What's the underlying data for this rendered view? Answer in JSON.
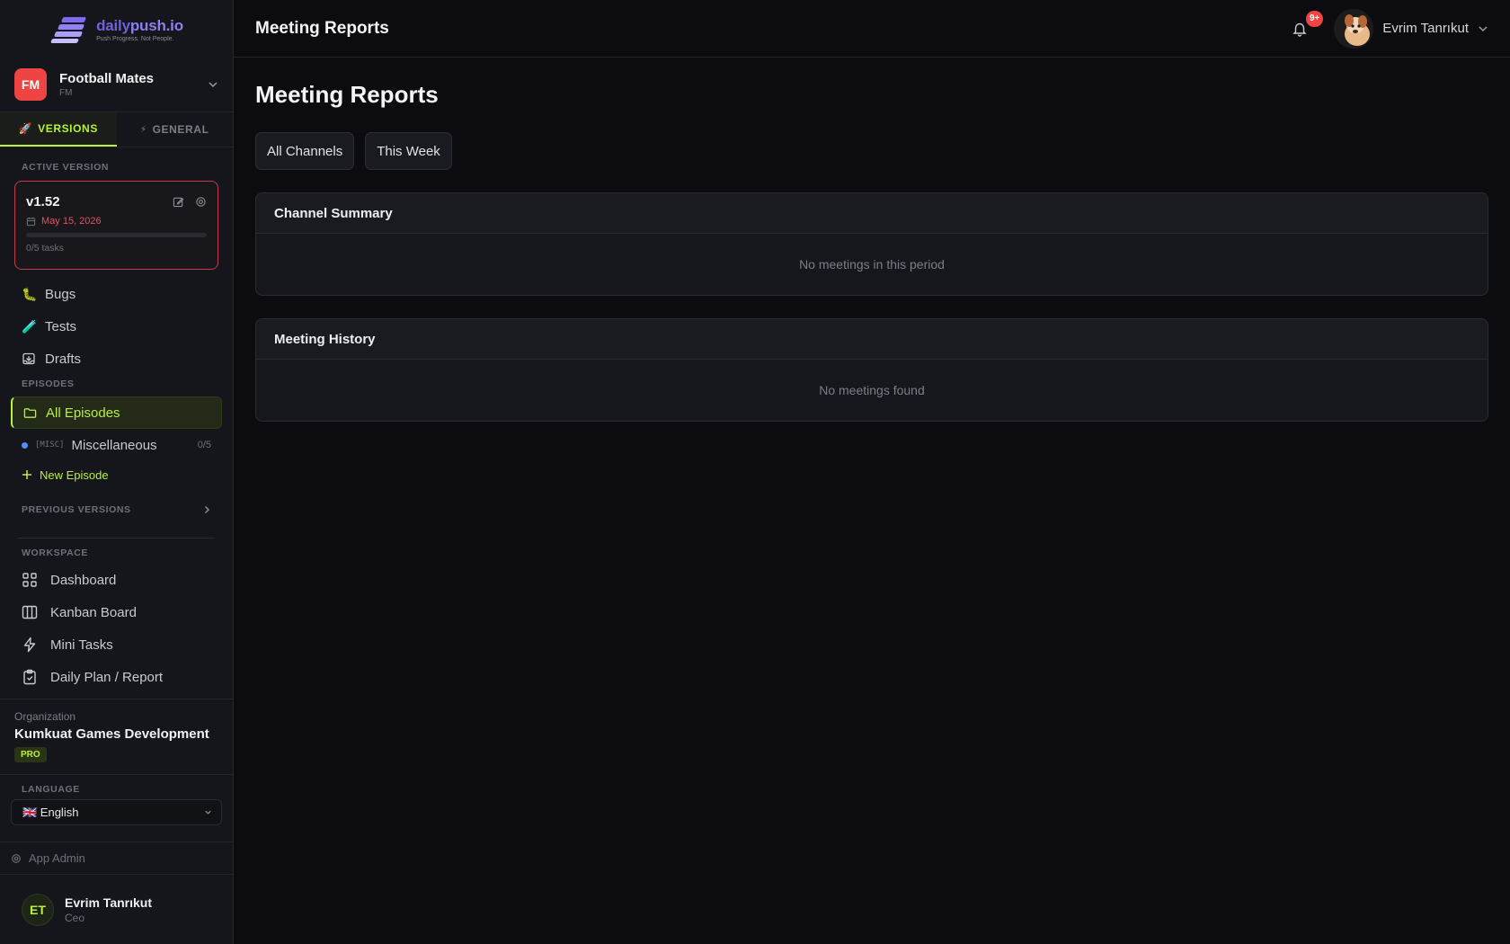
{
  "brand": {
    "name_part1": "daily",
    "name_part2": "push.io",
    "tagline": "Push Progress. Not People."
  },
  "project": {
    "initials": "FM",
    "name": "Football Mates",
    "code": "FM",
    "color": "#ef4444"
  },
  "tabs": [
    {
      "icon": "🚀",
      "label": "VERSIONS",
      "active": true
    },
    {
      "icon": "⚡",
      "label": "GENERAL",
      "active": false
    }
  ],
  "active_version": {
    "section_label": "ACTIVE VERSION",
    "title": "v1.52",
    "date": "May 15, 2026",
    "progress": 0,
    "tasks": "0/5 tasks"
  },
  "version_nav": [
    {
      "icon": "bug-icon",
      "label": "Bugs"
    },
    {
      "icon": "test-tube-icon",
      "label": "Tests"
    },
    {
      "icon": "inbox-icon",
      "label": "Drafts"
    }
  ],
  "episodes": {
    "section_label": "EPISODES",
    "all_label": "All Episodes",
    "items": [
      {
        "tag": "[MISC]",
        "label": "Miscellaneous",
        "count": "0/5",
        "color": "#4f8ff7"
      }
    ],
    "new_label": "New Episode"
  },
  "previous_versions_label": "PREVIOUS VERSIONS",
  "workspace": {
    "section_label": "WORKSPACE",
    "items": [
      {
        "icon": "grid-icon",
        "label": "Dashboard"
      },
      {
        "icon": "kanban-icon",
        "label": "Kanban Board"
      },
      {
        "icon": "lightning-icon",
        "label": "Mini Tasks"
      },
      {
        "icon": "clipboard-check-icon",
        "label": "Daily Plan / Report"
      }
    ]
  },
  "organization": {
    "label": "Organization",
    "name": "Kumkuat Games Development",
    "plan": "PRO"
  },
  "language": {
    "section_label": "LANGUAGE",
    "selected": "🇬🇧 English"
  },
  "app_admin_label": "App Admin",
  "footer_user": {
    "initials": "ET",
    "name": "Evrim Tanrıkut",
    "role": "Ceo"
  },
  "header": {
    "title": "Meeting Reports",
    "notification_badge": "9+",
    "user_name": "Evrim Tanrıkut"
  },
  "page": {
    "title": "Meeting Reports",
    "filters": {
      "channel": "All Channels",
      "period": "This Week"
    },
    "panels": [
      {
        "title": "Channel Summary",
        "empty_text": "No meetings in this period"
      },
      {
        "title": "Meeting History",
        "empty_text": "No meetings found"
      }
    ]
  },
  "colors": {
    "accent": "#b8f23a",
    "danger": "#ef4444",
    "brand": "#7b6cf0"
  }
}
